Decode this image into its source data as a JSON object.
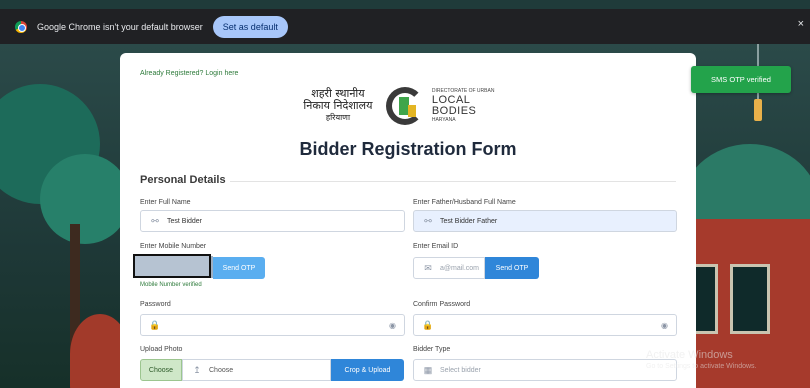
{
  "browser": {
    "infobar_text": "Google Chrome isn't your default browser",
    "set_default_label": "Set as default",
    "close_glyph": "×"
  },
  "toast": {
    "text": "SMS OTP verified",
    "color": "#23a34b"
  },
  "header": {
    "login_link": "Already Registered? Login here",
    "hindi_line1": "शहरी स्थानीय",
    "hindi_line2": "निकाय निदेशालय",
    "hindi_line3": "हरियाणा",
    "dept_line1": "DIRECTORATE OF URBAN",
    "dept_line2": "LOCAL BODIES",
    "dept_line3": "HARYANA",
    "form_title": "Bidder Registration Form"
  },
  "personal": {
    "section_title": "Personal Details",
    "full_name_label": "Enter Full Name",
    "full_name_value": "Test Bidder",
    "father_label": "Enter Father/Husband Full Name",
    "father_value": "Test Bidder Father",
    "mobile_label": "Enter Mobile Number",
    "mobile_send_otp": "Send OTP",
    "mobile_verified_note": "Mobile Number verified",
    "email_label": "Enter Email ID",
    "email_placeholder": "a@mail.com",
    "email_send_otp": "Send OTP",
    "password_label": "Password",
    "confirm_password_label": "Confirm Password",
    "upload_photo_label": "Upload Photo",
    "choose_button": "Choose",
    "choose_file_text": "Choose",
    "crop_upload_button": "Crop & Upload",
    "bidder_type_label": "Bidder Type",
    "bidder_type_placeholder": "Select bidder"
  },
  "watermark": {
    "line1": "Activate Windows",
    "line2": "Go to Settings to activate Windows."
  },
  "icons": {
    "user": "user-icon",
    "mail": "mail-icon",
    "lock": "lock-icon",
    "eye": "eye-icon",
    "upload": "upload-icon",
    "bidder": "building-icon"
  }
}
